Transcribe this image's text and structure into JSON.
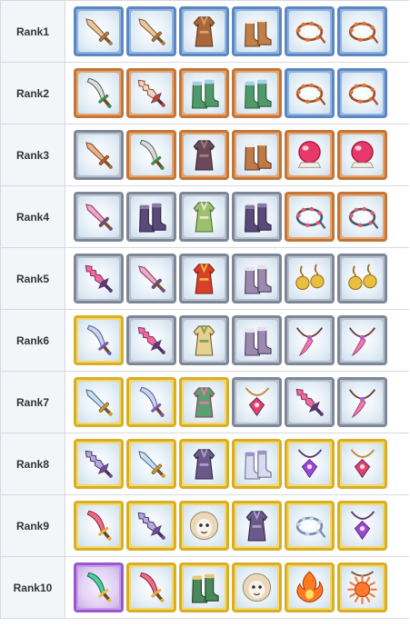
{
  "ranks": [
    {
      "label": "Rank1",
      "items": [
        {
          "icon": "wooden-sword-icon",
          "frame": "blue"
        },
        {
          "icon": "wooden-sword-icon",
          "frame": "blue"
        },
        {
          "icon": "leather-armor-icon",
          "frame": "blue"
        },
        {
          "icon": "fur-boots-icon",
          "frame": "blue"
        },
        {
          "icon": "bead-bracelet-icon",
          "frame": "blue"
        },
        {
          "icon": "bead-bracelet-icon",
          "frame": "blue"
        }
      ]
    },
    {
      "label": "Rank2",
      "items": [
        {
          "icon": "curved-sword-icon",
          "frame": "copper"
        },
        {
          "icon": "jagged-sword-icon",
          "frame": "copper"
        },
        {
          "icon": "green-boots-icon",
          "frame": "copper"
        },
        {
          "icon": "green-boots-icon",
          "frame": "copper"
        },
        {
          "icon": "bead-bracelet-icon",
          "frame": "blue"
        },
        {
          "icon": "bead-bracelet-icon",
          "frame": "blue"
        }
      ]
    },
    {
      "label": "Rank3",
      "items": [
        {
          "icon": "dagger-icon",
          "frame": "silver"
        },
        {
          "icon": "curved-sword-icon",
          "frame": "copper"
        },
        {
          "icon": "dark-robe-icon",
          "frame": "copper"
        },
        {
          "icon": "bone-boots-icon",
          "frame": "copper"
        },
        {
          "icon": "crystal-orb-icon",
          "frame": "copper"
        },
        {
          "icon": "crystal-orb-icon",
          "frame": "copper"
        }
      ]
    },
    {
      "label": "Rank4",
      "items": [
        {
          "icon": "pink-sword-icon",
          "frame": "silver"
        },
        {
          "icon": "purple-boots-icon",
          "frame": "silver"
        },
        {
          "icon": "green-robe-icon",
          "frame": "silver"
        },
        {
          "icon": "purple-boots-icon",
          "frame": "silver"
        },
        {
          "icon": "studded-bracelet-icon",
          "frame": "copper"
        },
        {
          "icon": "studded-bracelet-icon",
          "frame": "copper"
        }
      ]
    },
    {
      "label": "Rank5",
      "items": [
        {
          "icon": "crystal-sword-icon",
          "frame": "silver"
        },
        {
          "icon": "pink-sword-icon",
          "frame": "silver"
        },
        {
          "icon": "red-dress-icon",
          "frame": "silver"
        },
        {
          "icon": "armored-boots-icon",
          "frame": "silver"
        },
        {
          "icon": "gold-earrings-icon",
          "frame": "silver"
        },
        {
          "icon": "gold-earrings-icon",
          "frame": "silver"
        }
      ]
    },
    {
      "label": "Rank6",
      "items": [
        {
          "icon": "silver-blade-icon",
          "frame": "gold"
        },
        {
          "icon": "crystal-sword-icon",
          "frame": "silver"
        },
        {
          "icon": "hooded-cloak-icon",
          "frame": "silver"
        },
        {
          "icon": "armored-boots-icon",
          "frame": "silver"
        },
        {
          "icon": "feather-necklace-icon",
          "frame": "silver"
        },
        {
          "icon": "feather-necklace-icon",
          "frame": "silver"
        }
      ]
    },
    {
      "label": "Rank7",
      "items": [
        {
          "icon": "gold-sword-icon",
          "frame": "gold"
        },
        {
          "icon": "silver-blade-icon",
          "frame": "gold"
        },
        {
          "icon": "striped-dress-icon",
          "frame": "gold"
        },
        {
          "icon": "ruby-earring-icon",
          "frame": "silver"
        },
        {
          "icon": "crystal-sword-icon",
          "frame": "silver"
        },
        {
          "icon": "feather-necklace-icon",
          "frame": "silver"
        }
      ]
    },
    {
      "label": "Rank8",
      "items": [
        {
          "icon": "dark-blade-icon",
          "frame": "gold"
        },
        {
          "icon": "gold-sword-icon",
          "frame": "gold"
        },
        {
          "icon": "dark-skirt-icon",
          "frame": "gold"
        },
        {
          "icon": "silver-greaves-icon",
          "frame": "gold"
        },
        {
          "icon": "amethyst-pendant-icon",
          "frame": "gold"
        },
        {
          "icon": "ruby-earring-icon",
          "frame": "gold"
        }
      ]
    },
    {
      "label": "Rank9",
      "items": [
        {
          "icon": "feather-blade-icon",
          "frame": "gold"
        },
        {
          "icon": "dark-blade-icon",
          "frame": "gold"
        },
        {
          "icon": "lion-mask-icon",
          "frame": "gold"
        },
        {
          "icon": "dark-skirt-icon",
          "frame": "gold"
        },
        {
          "icon": "pearl-bracelet-icon",
          "frame": "gold"
        },
        {
          "icon": "amethyst-pendant-icon",
          "frame": "gold"
        }
      ]
    },
    {
      "label": "Rank10",
      "items": [
        {
          "icon": "emerald-dagger-icon",
          "frame": "purple"
        },
        {
          "icon": "feather-blade-icon",
          "frame": "gold"
        },
        {
          "icon": "jade-boots-icon",
          "frame": "gold"
        },
        {
          "icon": "lion-mask-icon",
          "frame": "gold"
        },
        {
          "icon": "fire-charm-icon",
          "frame": "gold"
        },
        {
          "icon": "sun-pendant-icon",
          "frame": "gold"
        }
      ]
    }
  ]
}
